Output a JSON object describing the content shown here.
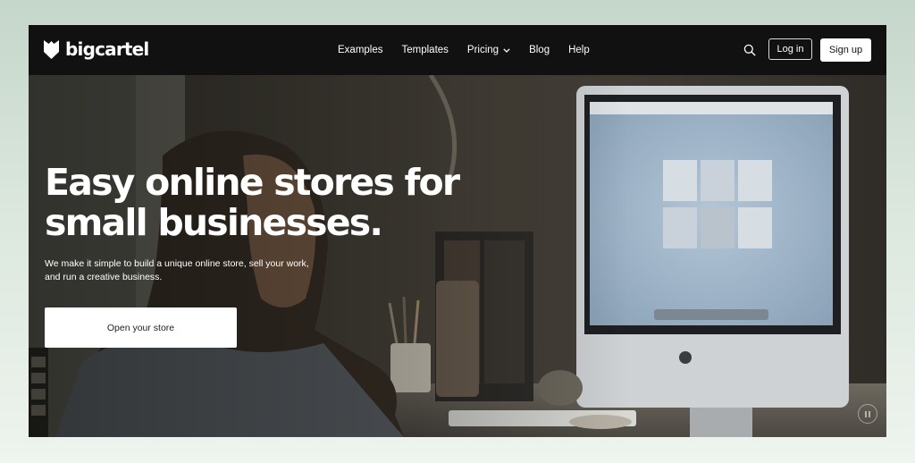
{
  "brand": {
    "name": "bigcartel",
    "logo_icon": "bigcartel-shield-logo"
  },
  "nav": {
    "items": [
      {
        "label": "Examples"
      },
      {
        "label": "Templates"
      },
      {
        "label": "Pricing",
        "has_dropdown": true
      },
      {
        "label": "Blog"
      },
      {
        "label": "Help"
      }
    ]
  },
  "header_actions": {
    "search_icon": "search-icon",
    "login_label": "Log in",
    "signup_label": "Sign up"
  },
  "hero": {
    "headline_line1": "Easy online stores for",
    "headline_line2": "small businesses.",
    "subtext_line1": "We make it simple to build a unique online store, sell your work,",
    "subtext_line2": "and run a creative business.",
    "cta_label": "Open your store",
    "video_control_icon": "pause-icon",
    "background": "woman working at a desktop computer in a dim studio"
  },
  "colors": {
    "page_bg_top": "#c5d6ca",
    "page_bg_bottom": "#eef4ee",
    "header_bg": "#111111",
    "button_light": "#ffffff",
    "text_on_dark": "#ffffff"
  }
}
